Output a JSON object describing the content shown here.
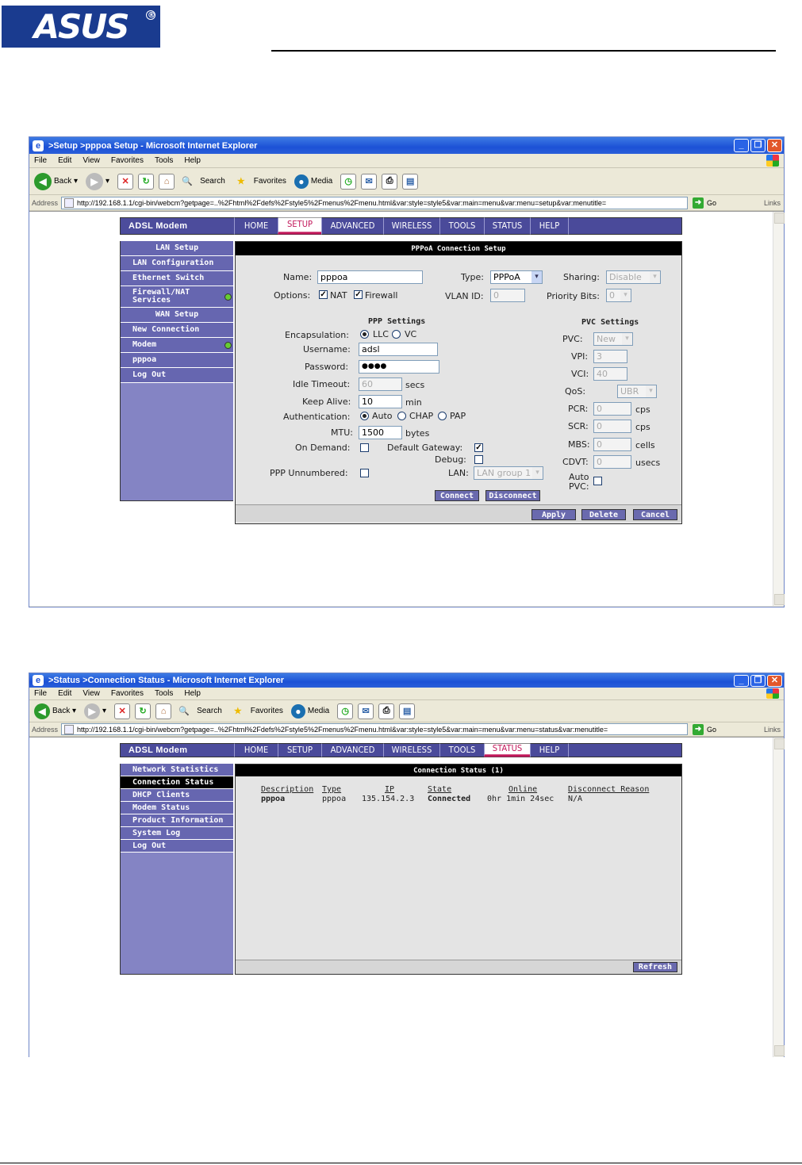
{
  "logo": {
    "text": "ASUS",
    "mark": "®"
  },
  "window1": {
    "title": ">Setup >pppoa Setup - Microsoft Internet Explorer",
    "menu": [
      "File",
      "Edit",
      "View",
      "Favorites",
      "Tools",
      "Help"
    ],
    "toolbar": {
      "back": "Back",
      "search": "Search",
      "favorites": "Favorites",
      "media": "Media"
    },
    "address_label": "Address",
    "url": "http://192.168.1.1/cgi-bin/webcm?getpage=..%2Fhtml%2Fdefs%2Fstyle5%2Fmenus%2Fmenu.html&var:style=style5&var:main=menu&var:menu=setup&var:menutitle=",
    "go": "Go",
    "links": "Links",
    "router": {
      "brand": "ADSL Modem",
      "tabs": [
        "HOME",
        "SETUP",
        "ADVANCED",
        "WIRELESS",
        "TOOLS",
        "STATUS",
        "HELP"
      ],
      "active_tab": "SETUP",
      "sidebar": [
        "LAN Setup",
        "LAN Configuration",
        "Ethernet Switch",
        "Firewall/NAT Services",
        "WAN Setup",
        "New Connection",
        "Modem",
        "pppoa",
        "Log Out"
      ],
      "panel_title": "PPPoA Connection Setup",
      "form": {
        "name_label": "Name:",
        "name_value": "pppoa",
        "type_label": "Type:",
        "type_value": "PPPoA",
        "sharing_label": "Sharing:",
        "sharing_value": "Disable",
        "options_label": "Options:",
        "nat_label": "NAT",
        "firewall_label": "Firewall",
        "vlan_label": "VLAN ID:",
        "vlan_value": "0",
        "priority_label": "Priority Bits:",
        "priority_value": "0",
        "ppp_settings": "PPP Settings",
        "pvc_settings": "PVC Settings",
        "encapsulation_label": "Encapsulation:",
        "llc": "LLC",
        "vc": "VC",
        "username_label": "Username:",
        "username_value": "adsl",
        "password_label": "Password:",
        "password_value": "●●●●",
        "idle_label": "Idle Timeout:",
        "idle_value": "60",
        "idle_unit": "secs",
        "keepalive_label": "Keep Alive:",
        "keepalive_value": "10",
        "keepalive_unit": "min",
        "auth_label": "Authentication:",
        "auth_auto": "Auto",
        "auth_chap": "CHAP",
        "auth_pap": "PAP",
        "mtu_label": "MTU:",
        "mtu_value": "1500",
        "mtu_unit": "bytes",
        "ondemand_label": "On Demand:",
        "defgw_label": "Default Gateway:",
        "debug_label": "Debug:",
        "unnumbered_label": "PPP Unnumbered:",
        "lan_label": "LAN:",
        "lan_value": "LAN group 1",
        "pvc_label": "PVC:",
        "pvc_value": "New",
        "vpi_label": "VPI:",
        "vpi_value": "3",
        "vci_label": "VCI:",
        "vci_value": "40",
        "qos_label": "QoS:",
        "qos_value": "UBR",
        "pcr_label": "PCR:",
        "pcr_value": "0",
        "pcr_unit": "cps",
        "scr_label": "SCR:",
        "scr_value": "0",
        "scr_unit": "cps",
        "mbs_label": "MBS:",
        "mbs_value": "0",
        "mbs_unit": "cells",
        "cdvt_label": "CDVT:",
        "cdvt_value": "0",
        "cdvt_unit": "usecs",
        "autopvc_label1": "Auto",
        "autopvc_label2": "PVC:",
        "connect": "Connect",
        "disconnect": "Disconnect",
        "apply": "Apply",
        "delete": "Delete",
        "cancel": "Cancel"
      }
    }
  },
  "window2": {
    "title": ">Status >Connection Status - Microsoft Internet Explorer",
    "menu": [
      "File",
      "Edit",
      "View",
      "Favorites",
      "Tools",
      "Help"
    ],
    "toolbar": {
      "back": "Back",
      "search": "Search",
      "favorites": "Favorites",
      "media": "Media"
    },
    "address_label": "Address",
    "url": "http://192.168.1.1/cgi-bin/webcm?getpage=..%2Fhtml%2Fdefs%2Fstyle5%2Fmenus%2Fmenu.html&var:style=style5&var:main=menu&var:menu=status&var:menutitle=",
    "go": "Go",
    "links": "Links",
    "router": {
      "brand": "ADSL Modem",
      "tabs": [
        "HOME",
        "SETUP",
        "ADVANCED",
        "WIRELESS",
        "TOOLS",
        "STATUS",
        "HELP"
      ],
      "active_tab": "STATUS",
      "sidebar": [
        "Network Statistics",
        "Connection Status",
        "DHCP Clients",
        "Modem Status",
        "Product Information",
        "System Log",
        "Log Out"
      ],
      "panel_title": "Connection Status (1)",
      "table": {
        "headers": [
          "Description",
          "Type",
          "IP",
          "State",
          "Online",
          "Disconnect Reason"
        ],
        "rows": [
          [
            "pppoa",
            "pppoa",
            "135.154.2.3",
            "Connected",
            "0hr 1min 24sec",
            "N/A"
          ]
        ]
      },
      "refresh": "Refresh"
    }
  }
}
